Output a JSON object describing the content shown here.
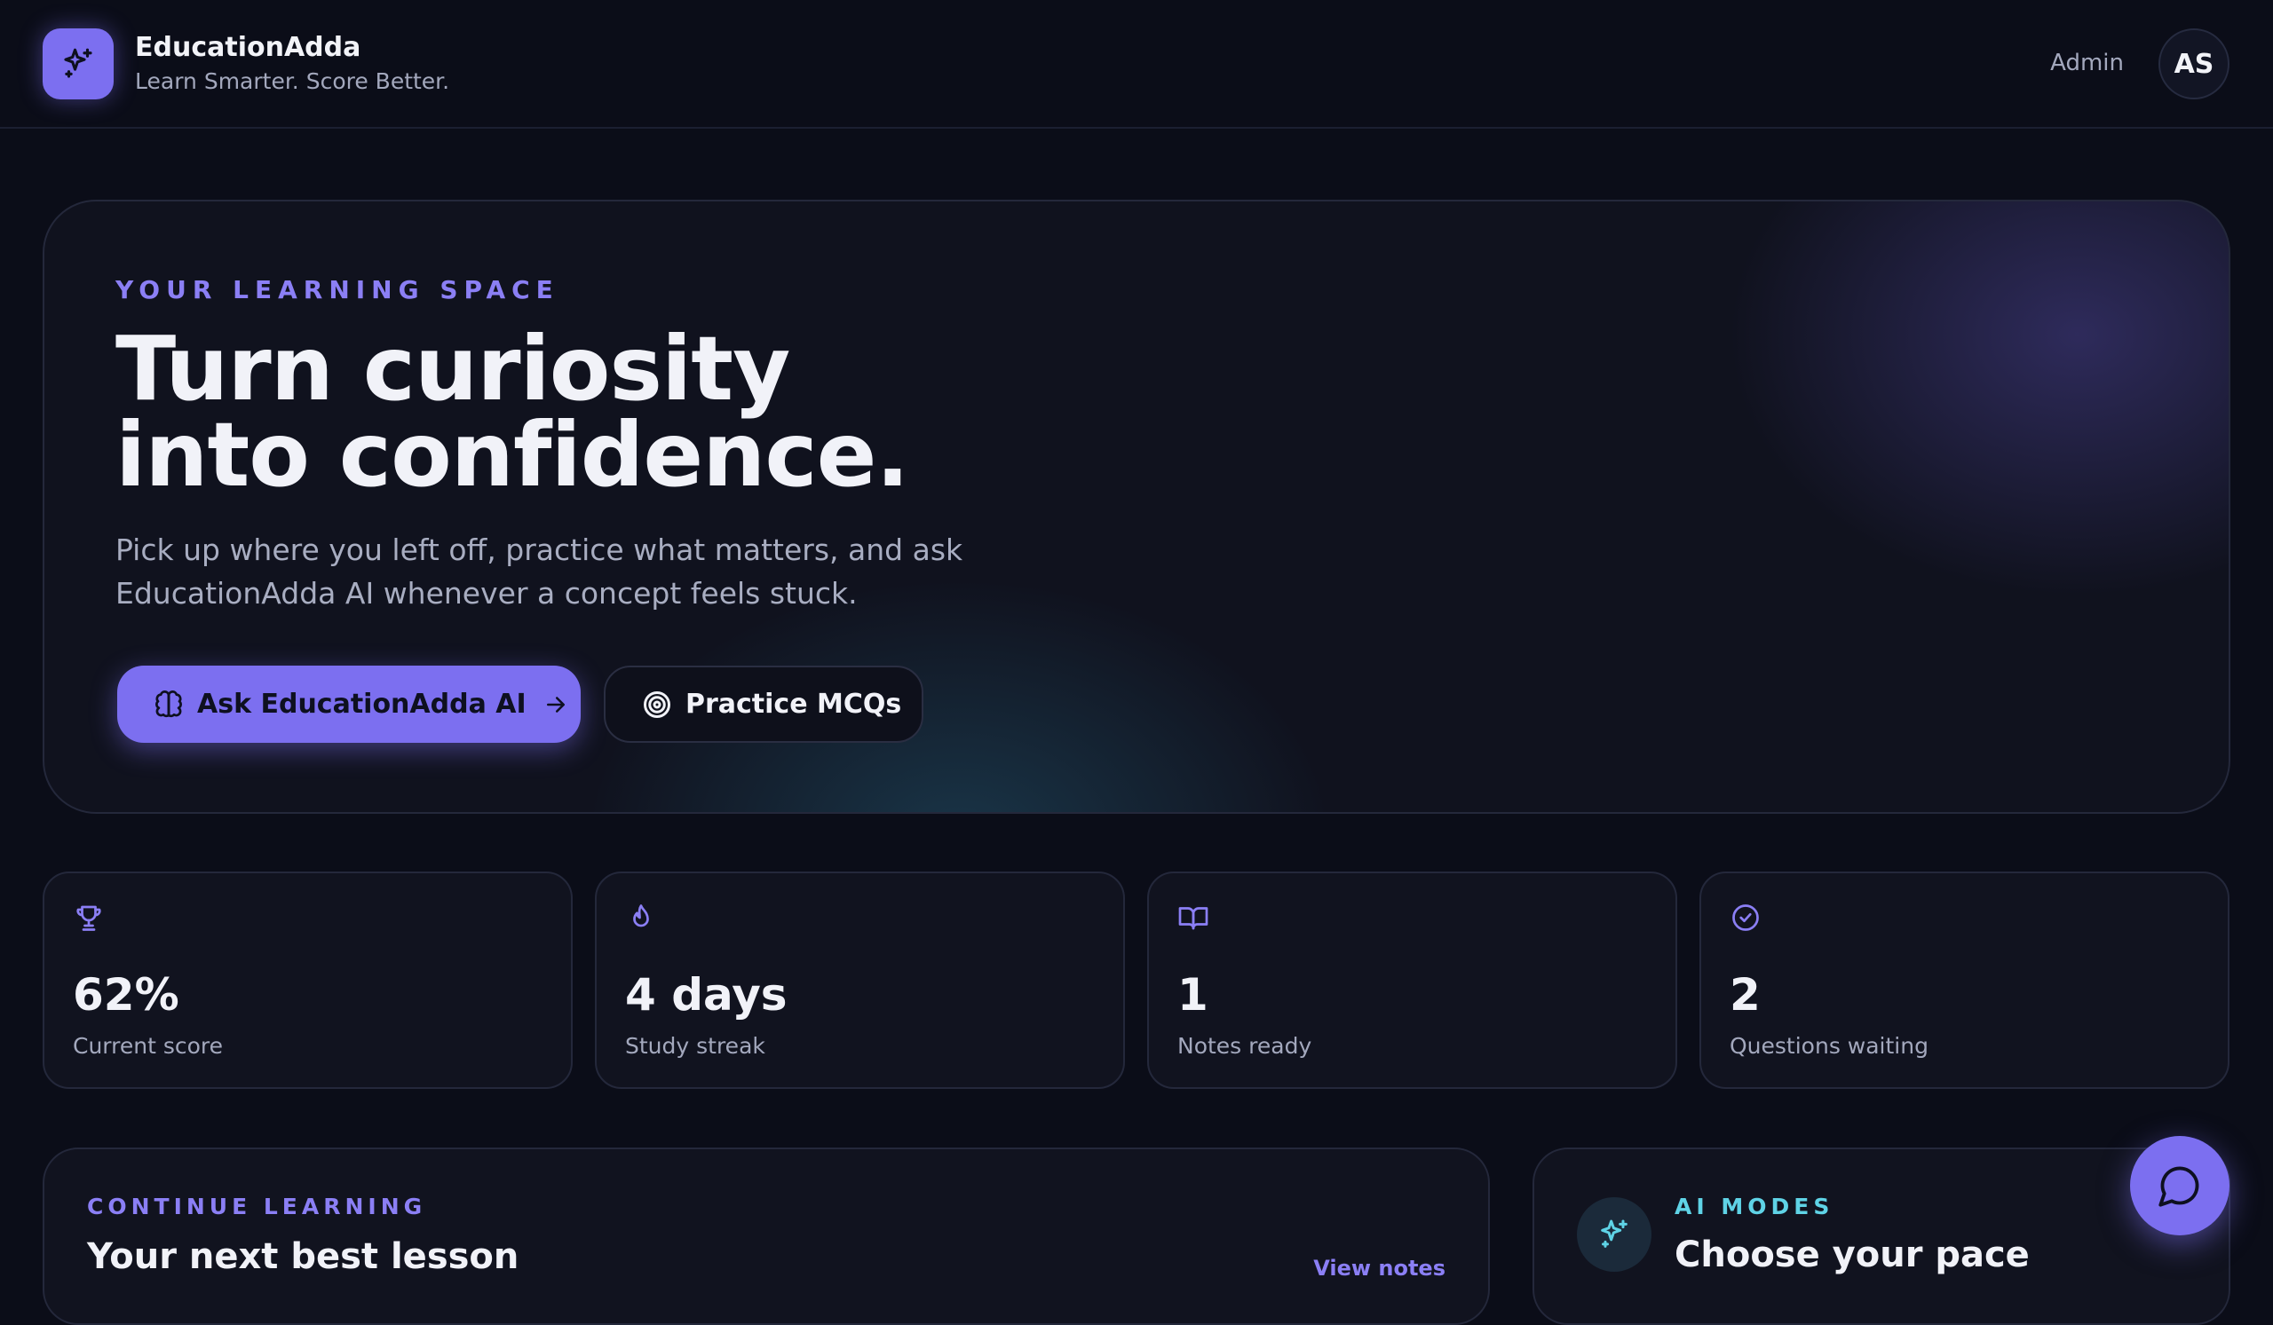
{
  "header": {
    "brand_name": "EducationAdda",
    "tagline": "Learn Smarter. Score Better.",
    "role": "Admin",
    "avatar_initials": "AS",
    "logo_icon": "sparkles-icon"
  },
  "hero": {
    "eyebrow": "YOUR LEARNING SPACE",
    "title_line1": "Turn curiosity",
    "title_line2": "into confidence.",
    "subtitle": "Pick up where you left off, practice what matters, and ask EducationAdda AI whenever a concept feels stuck.",
    "primary_button": {
      "label": "Ask EducationAdda AI",
      "icon": "brain-icon",
      "trailing_icon": "arrow-right-icon"
    },
    "secondary_button": {
      "label": "Practice MCQs",
      "icon": "target-icon"
    }
  },
  "stats": [
    {
      "icon": "trophy-icon",
      "value": "62%",
      "label": "Current score"
    },
    {
      "icon": "flame-icon",
      "value": "4 days",
      "label": "Study streak"
    },
    {
      "icon": "book-open-icon",
      "value": "1",
      "label": "Notes ready"
    },
    {
      "icon": "check-circle-icon",
      "value": "2",
      "label": "Questions waiting"
    }
  ],
  "continue_learning": {
    "eyebrow": "CONTINUE LEARNING",
    "title": "Your next best lesson",
    "link": "View notes"
  },
  "ai_modes": {
    "eyebrow": "AI MODES",
    "title": "Choose your pace",
    "icon": "sparkles-icon"
  },
  "chat_fab": {
    "icon": "chat-bubble-icon"
  },
  "colors": {
    "background": "#0b0d18",
    "accent": "#7c6ff0",
    "accent_text": "#8b7ff5",
    "teal": "#5fd3e6",
    "card": "#11131f"
  }
}
